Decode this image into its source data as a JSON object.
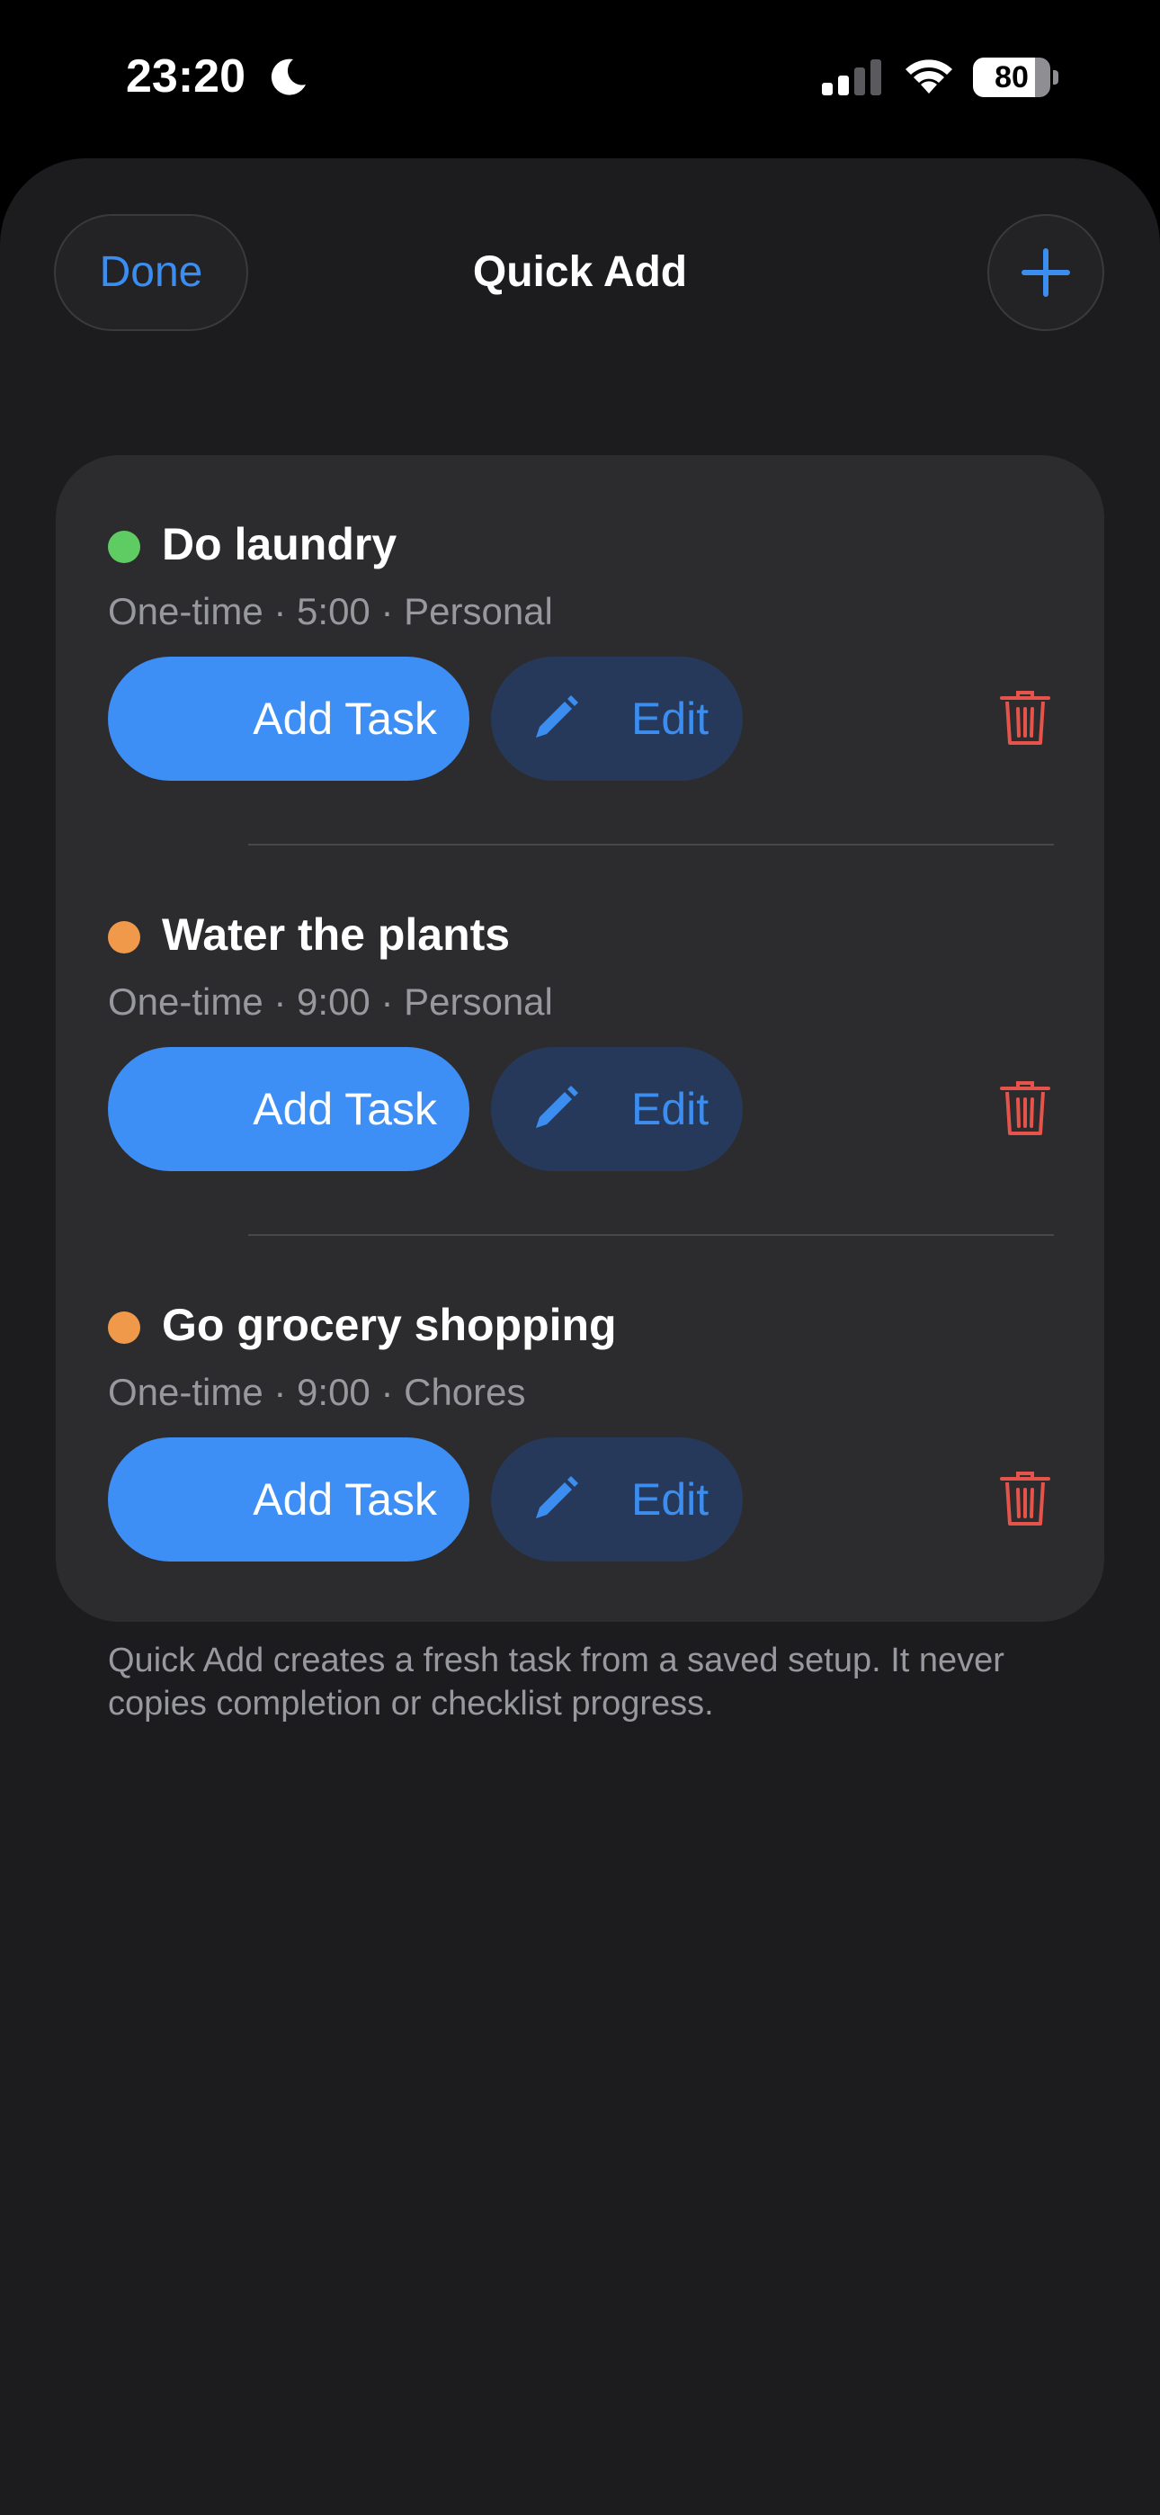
{
  "status_bar": {
    "time": "23:20",
    "battery_percent": 80,
    "battery_label": "80",
    "icons": [
      "moon-icon",
      "cellular-signal-icon",
      "wifi-icon",
      "battery-icon"
    ]
  },
  "header": {
    "done_label": "Done",
    "title": "Quick Add",
    "add_icon": "plus-icon"
  },
  "tasks": [
    {
      "title": "Do laundry",
      "meta": "One-time · 5:00 · Personal",
      "dot_color": "#5ecc62",
      "add_task_label": "Add Task",
      "edit_label": "Edit"
    },
    {
      "title": "Water the plants",
      "meta": "One-time · 9:00 · Personal",
      "dot_color": "#f0994a",
      "add_task_label": "Add Task",
      "edit_label": "Edit"
    },
    {
      "title": "Go grocery shopping",
      "meta": "One-time · 9:00 · Chores",
      "dot_color": "#f0994a",
      "add_task_label": "Add Task",
      "edit_label": "Edit"
    }
  ],
  "footer": {
    "note": "Quick Add creates a fresh task from a saved setup. It never copies completion or checklist progress."
  },
  "colors": {
    "accent": "#3b8ef0",
    "delete": "#e5534b",
    "sheet_background": "#1c1c1e",
    "card_background": "#2c2c2e"
  }
}
